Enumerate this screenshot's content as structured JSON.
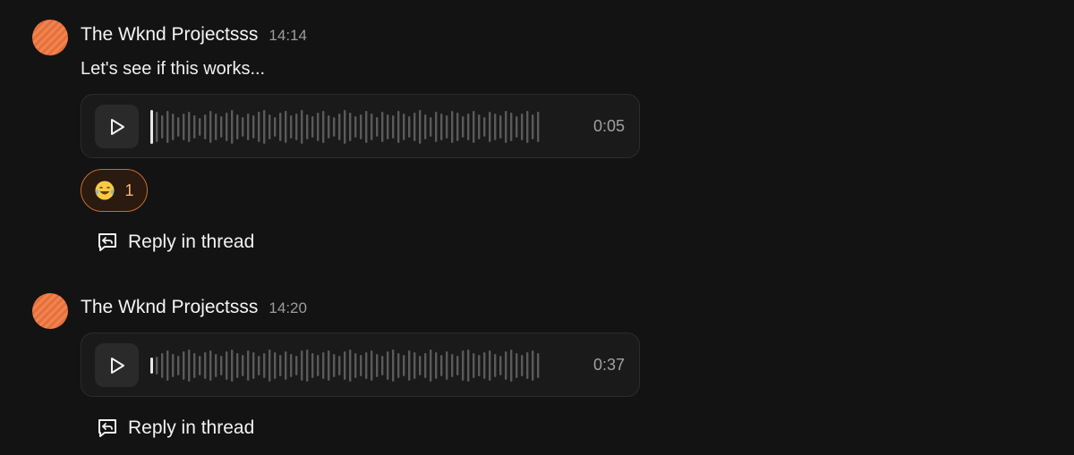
{
  "messages": [
    {
      "author": "The Wknd Projectsss",
      "time": "14:14",
      "text": "Let's see if this works...",
      "voice": {
        "duration": "0:05",
        "progress": 0.0
      },
      "reactions": [
        {
          "emoji": "😂",
          "count": "1",
          "icon": "laughing-emoji-icon"
        }
      ],
      "reply_label": "Reply in thread"
    },
    {
      "author": "The Wknd Projectsss",
      "time": "14:20",
      "voice": {
        "duration": "0:37",
        "progress": 0.0
      },
      "reply_label": "Reply in thread"
    }
  ],
  "colors": {
    "background": "#131313",
    "accent": "#f0834f",
    "reaction_border": "#c86a34",
    "wave_bar": "#5a5a5a"
  }
}
